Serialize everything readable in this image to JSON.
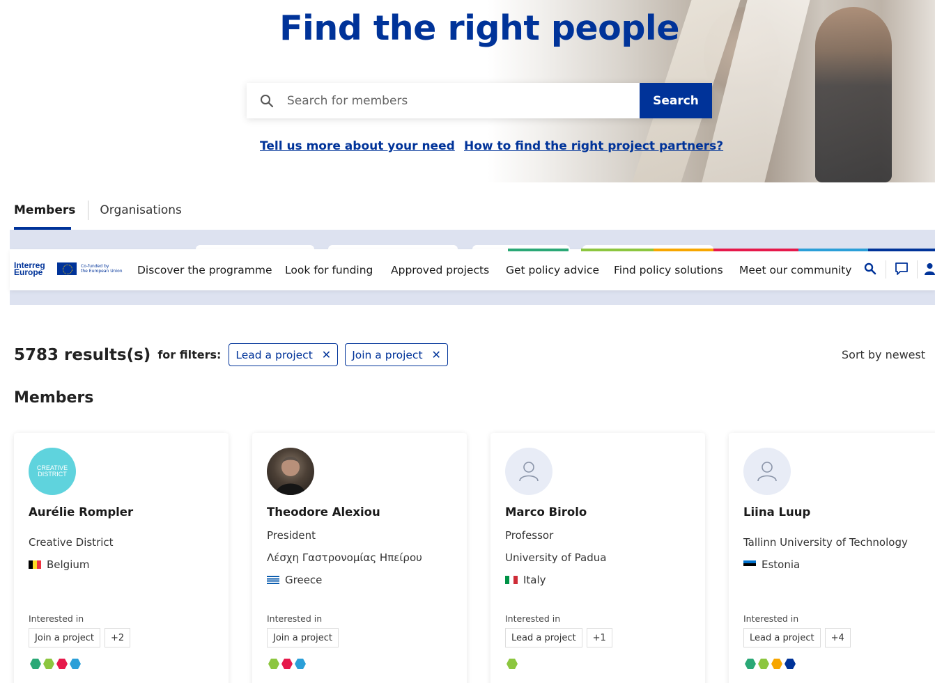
{
  "hero": {
    "title": "Find the right people",
    "search_placeholder": "Search for members",
    "search_button": "Search",
    "link_need": "Tell us more about your need",
    "link_partners": "How to find the right project partners?"
  },
  "tabs": [
    {
      "label": "Members",
      "active": true
    },
    {
      "label": "Organisations",
      "active": false
    }
  ],
  "navbar": {
    "logo_line1": "Interreg",
    "logo_line2": "Europe",
    "cofund_line1": "Co-funded by",
    "cofund_line2": "the European Union",
    "items": [
      "Discover the programme",
      "Look for funding",
      "Approved projects",
      "Get policy advice",
      "Find policy solutions",
      "Meet our community"
    ],
    "icons": [
      "search-icon",
      "chat-icon",
      "user-icon"
    ],
    "accent_colors": [
      "#2aa876",
      "#8cc63f",
      "#f7a600",
      "#e6194b",
      "#2b9fd8",
      "#003399"
    ]
  },
  "results": {
    "count": "5783 results(s)",
    "filters_label": "for filters:",
    "filters": [
      "Lead a project",
      "Join a project"
    ],
    "sort": "Sort by newest"
  },
  "members_heading": "Members",
  "cards": [
    {
      "name": "Aurélie Rompler",
      "avatar_text": "CREATIVE DISTRICT",
      "org": "Creative District",
      "country": "Belgium",
      "interested_label": "Interested in",
      "tags": [
        "Join a project",
        "+2"
      ],
      "hex_colors": [
        "#2aa876",
        "#8cc63f",
        "#e6194b",
        "#2b9fd8"
      ]
    },
    {
      "name": "Theodore Alexiou",
      "role": "President",
      "org": "Λέσχη Γαστρονομίας Ηπείρου",
      "country": "Greece",
      "interested_label": "Interested in",
      "tags": [
        "Join a project"
      ],
      "hex_colors": [
        "#8cc63f",
        "#e6194b",
        "#2b9fd8"
      ]
    },
    {
      "name": "Marco Birolo",
      "role": "Professor",
      "org": "University of Padua",
      "country": "Italy",
      "interested_label": "Interested in",
      "tags": [
        "Lead a project",
        "+1"
      ],
      "hex_colors": [
        "#8cc63f"
      ]
    },
    {
      "name": "Liina Luup",
      "org": "Tallinn University of Technology",
      "country": "Estonia",
      "interested_label": "Interested in",
      "tags": [
        "Lead a project",
        "+4"
      ],
      "hex_colors": [
        "#2aa876",
        "#8cc63f",
        "#f7a600",
        "#003399"
      ]
    }
  ]
}
